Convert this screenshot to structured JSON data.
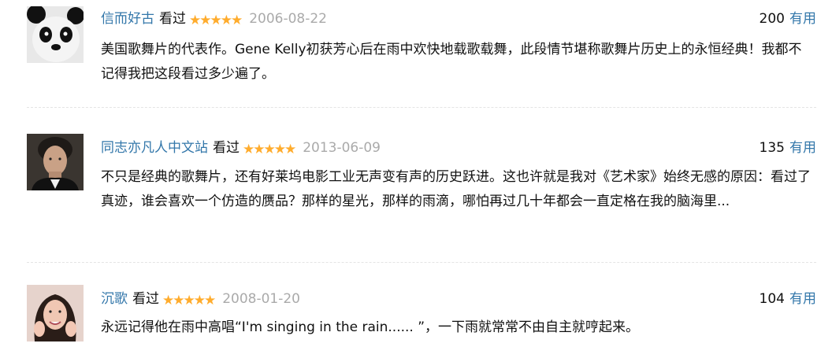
{
  "comments": [
    {
      "user": "信而好古",
      "status": "看过",
      "stars": "★★★★★",
      "date": "2006-08-22",
      "votes": "200",
      "useful_label": "有用",
      "text": "美国歌舞片的代表作。Gene Kelly初获芳心后在雨中欢快地载歌载舞，此段情节堪称歌舞片历史上的永恒经典！我都不记得我把这段看过多少遍了。"
    },
    {
      "user": "同志亦凡人中文站",
      "status": "看过",
      "stars": "★★★★★",
      "date": "2013-06-09",
      "votes": "135",
      "useful_label": "有用",
      "text": "不只是经典的歌舞片，还有好莱坞电影工业无声变有声的历史跃进。这也许就是我对《艺术家》始终无感的原因：看过了真迹，谁会喜欢一个仿造的赝品？那样的星光，那样的雨滴，哪怕再过几十年都会一直定格在我的脑海里..."
    },
    {
      "user": "沉歌",
      "status": "看过",
      "stars": "★★★★★",
      "date": "2008-01-20",
      "votes": "104",
      "useful_label": "有用",
      "text": "永远记得他在雨中高唱“I'm singing in the rain...... ”，一下雨就常常不由自主就哼起来。"
    }
  ],
  "colors": {
    "link": "#3377aa",
    "star": "#ffac2d",
    "date": "#aaaaaa",
    "text": "#111111"
  }
}
